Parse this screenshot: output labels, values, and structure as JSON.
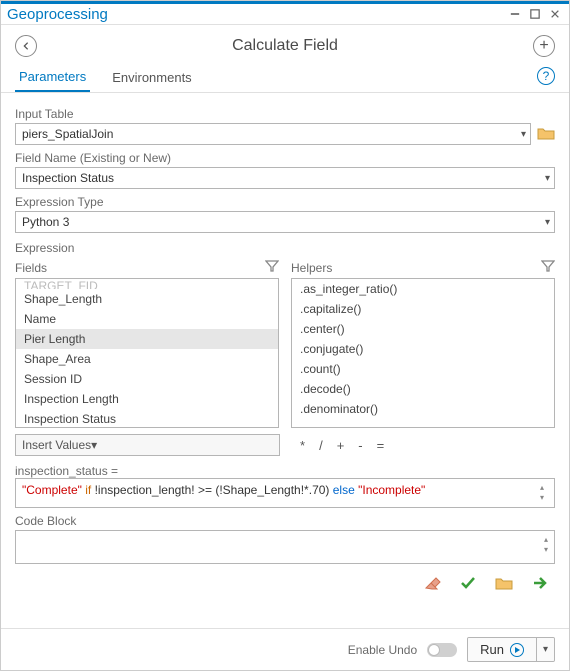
{
  "window": {
    "title": "Geoprocessing"
  },
  "tool": {
    "title": "Calculate Field"
  },
  "tabs": {
    "parameters": "Parameters",
    "environments": "Environments"
  },
  "labels": {
    "input_table": "Input Table",
    "field_name": "Field Name (Existing or New)",
    "expression_type": "Expression Type",
    "expression": "Expression",
    "fields": "Fields",
    "helpers": "Helpers",
    "insert_values": "Insert Values",
    "code_block": "Code Block",
    "enable_undo": "Enable Undo",
    "run": "Run"
  },
  "values": {
    "input_table": "piers_SpatialJoin",
    "field_name": "Inspection Status",
    "expression_type": "Python 3",
    "expression_target": "inspection_status ="
  },
  "fields_list": [
    "TARGET_FID",
    "Shape_Length",
    "Name",
    "Pier Length",
    "Shape_Area",
    "Session ID",
    "Inspection Length",
    "Inspection Status"
  ],
  "fields_selected": "Pier Length",
  "helpers_list": [
    ".as_integer_ratio()",
    ".capitalize()",
    ".center()",
    ".conjugate()",
    ".count()",
    ".decode()",
    ".denominator()"
  ],
  "operators": [
    "*",
    "/",
    "+",
    "-",
    "="
  ],
  "expression": {
    "str1": "\"Complete\"",
    "if": " if ",
    "cond": "!inspection_length! >= (!Shape_Length!*.70)",
    "else": " else ",
    "str2": "\"Incomplete\""
  }
}
